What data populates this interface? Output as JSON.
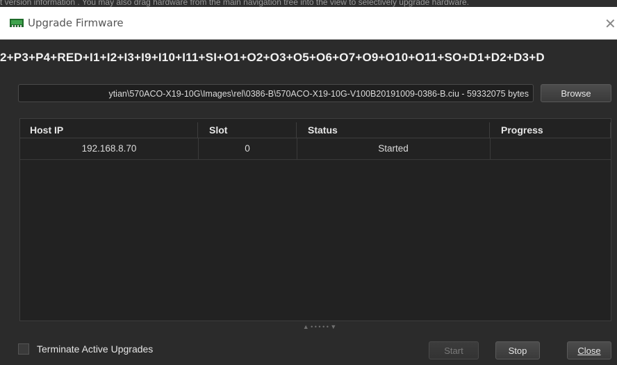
{
  "background_text": "t version information . You may also drag hardware from the main navigation tree into the view to selectively upgrade hardware.",
  "window": {
    "title": "Upgrade Firmware",
    "close_glyph": "✕"
  },
  "targets_text": "2+P3+P4+RED+I1+I2+I3+I9+I10+I11+SI+O1+O2+O3+O5+O6+O7+O9+O10+O11+SO+D1+D2+D3+D",
  "file": {
    "path": "ytian\\570ACO-X19-10G\\Images\\rel\\0386-B\\570ACO-X19-10G-V100B20191009-0386-B.ciu  -  59332075 bytes",
    "browse_label": "Browse"
  },
  "table": {
    "columns": [
      "Host IP",
      "Slot",
      "Status",
      "Progress"
    ],
    "rows": [
      {
        "host_ip": "192.168.8.70",
        "slot": "0",
        "status": "Started",
        "progress": ""
      }
    ]
  },
  "splitter_glyph": "▲ • • • • • ▼",
  "footer": {
    "terminate_label": "Terminate Active Upgrades",
    "terminate_checked": false,
    "start_label": "Start",
    "stop_label": "Stop",
    "close_label": "Close"
  },
  "icons": {
    "app": "firmware-card-icon",
    "close": "close-icon"
  },
  "colors": {
    "dialog_bg": "#2b2b2b",
    "titlebar_bg": "#ffffff",
    "icon_green": "#2f8a3a"
  }
}
